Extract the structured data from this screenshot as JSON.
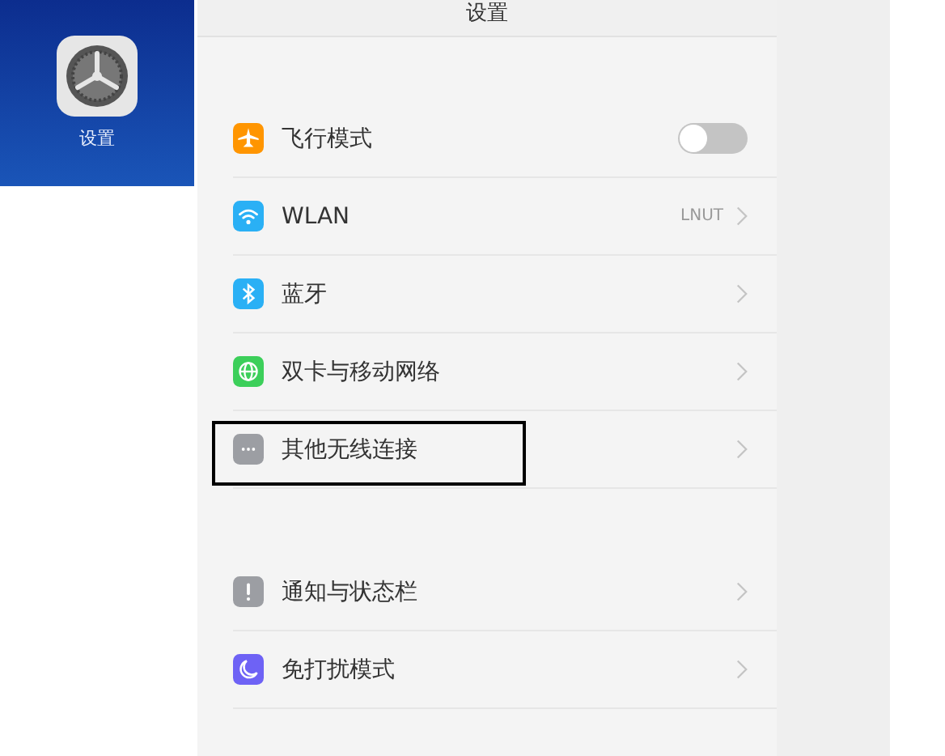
{
  "home_tile": {
    "app_label": "设置"
  },
  "settings": {
    "title": "设置",
    "groups": [
      {
        "rows": [
          {
            "kind": "toggle",
            "color": "#ff9500",
            "label": "飞行模式",
            "on": false,
            "highlighted": false
          },
          {
            "kind": "link",
            "color": "#2ab0f5",
            "label": "WLAN",
            "value": "LNUT",
            "highlighted": false
          },
          {
            "kind": "link",
            "color": "#2ab0f5",
            "label": "蓝牙",
            "highlighted": false
          },
          {
            "kind": "link",
            "color": "#3ccf5a",
            "label": "双卡与移动网络",
            "highlighted": false
          },
          {
            "kind": "link",
            "color": "#9c9ea3",
            "label": "其他无线连接",
            "highlighted": true
          }
        ]
      },
      {
        "rows": [
          {
            "kind": "link",
            "color": "#9c9ea3",
            "label": "通知与状态栏",
            "highlighted": false
          },
          {
            "kind": "link",
            "color": "#6e62f5",
            "label": "免打扰模式",
            "highlighted": false
          }
        ]
      }
    ]
  }
}
